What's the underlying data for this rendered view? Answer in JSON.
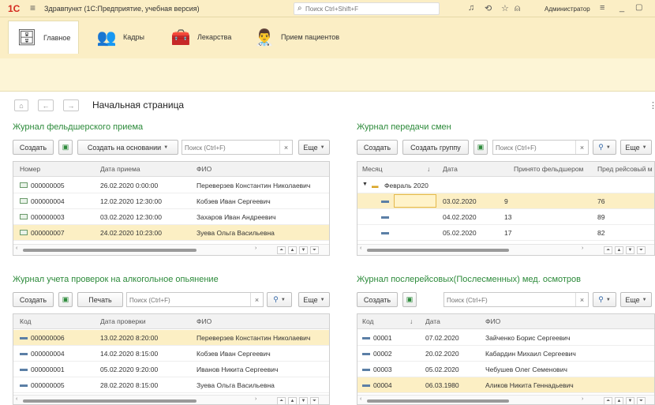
{
  "topbar": {
    "logo": "1С",
    "app_title": "Здравпункт (1С:Предприятие, учебная версия)",
    "search_placeholder": "Поиск Ctrl+Shift+F",
    "user": "Администратор"
  },
  "sections": [
    {
      "label": "Главное"
    },
    {
      "label": "Кадры"
    },
    {
      "label": "Лекарства"
    },
    {
      "label": "Прием пациентов"
    }
  ],
  "page": {
    "title": "Начальная страница"
  },
  "panel1": {
    "title": "Журнал фельдшерского приема",
    "create": "Создать",
    "create_based": "Создать на основании",
    "search_placeholder": "Поиск (Ctrl+F)",
    "more": "Еще",
    "columns": [
      "Номер",
      "Дата приема",
      "ФИО"
    ],
    "rows": [
      [
        "000000005",
        "26.02.2020 0:00:00",
        "Переверзев Константин Николаевич"
      ],
      [
        "000000004",
        "12.02.2020 12:30:00",
        "Кобзев Иван Сергеевич"
      ],
      [
        "000000003",
        "03.02.2020 12:30:00",
        "Захаров Иван Андреевич"
      ],
      [
        "000000007",
        "24.02.2020 10:23:00",
        "Зуева Ольга Васильевна"
      ]
    ]
  },
  "panel2": {
    "title": "Журнал передачи смен",
    "create": "Создать",
    "create_group": "Создать группу",
    "search_placeholder": "Поиск (Ctrl+F)",
    "more": "Еще",
    "columns": [
      "Месяц",
      "↓",
      "Дата",
      "Принято фельдшером",
      "Пред рейсовый м"
    ],
    "group": "Февраль 2020",
    "rows": [
      [
        "03.02.2020",
        "9",
        "76"
      ],
      [
        "04.02.2020",
        "13",
        "89"
      ],
      [
        "05.02.2020",
        "17",
        "82"
      ]
    ]
  },
  "panel3": {
    "title": "Журнал учета проверок на алкогольное опьянение",
    "create": "Создать",
    "print": "Печать",
    "search_placeholder": "Поиск (Ctrl+F)",
    "more": "Еще",
    "columns": [
      "Код",
      "Дата проверки",
      "ФИО"
    ],
    "rows": [
      [
        "000000006",
        "13.02.2020 8:20:00",
        "Переверзев Константин Николаевич"
      ],
      [
        "000000004",
        "14.02.2020 8:15:00",
        "Кобзев Иван Сергеевич"
      ],
      [
        "000000001",
        "05.02.2020 9:20:00",
        "Иванов Никита Сергеевич"
      ],
      [
        "000000005",
        "28.02.2020 8:15:00",
        "Зуева Ольга Васильевна"
      ]
    ]
  },
  "panel4": {
    "title": "Журнал послерейсовых(Послесменных) мед. осмотров",
    "create": "Создать",
    "search_placeholder": "Поиск (Ctrl+F)",
    "more": "Еще",
    "columns": [
      "Код",
      "↓",
      "Дата",
      "ФИО"
    ],
    "rows": [
      [
        "00001",
        "07.02.2020",
        "Зайченко Борис Сергеевич"
      ],
      [
        "00002",
        "20.02.2020",
        "Кабардин Михаил Сергеевич"
      ],
      [
        "00003",
        "05.02.2020",
        "Чебушев Олег Семенович"
      ],
      [
        "00004",
        "06.03.1980",
        "Аликов Никита Геннадьевич"
      ]
    ]
  }
}
